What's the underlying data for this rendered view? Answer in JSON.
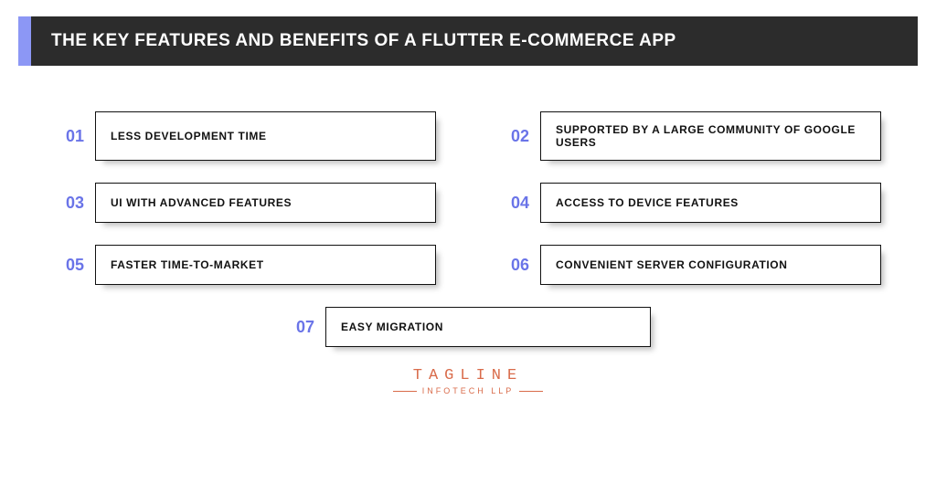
{
  "header": {
    "title": "THE KEY FEATURES AND BENEFITS OF A FLUTTER E-COMMERCE APP"
  },
  "items": [
    {
      "num": "01",
      "label": "LESS DEVELOPMENT TIME"
    },
    {
      "num": "02",
      "label": "SUPPORTED BY A LARGE COMMUNITY OF GOOGLE USERS"
    },
    {
      "num": "03",
      "label": "UI WITH ADVANCED FEATURES"
    },
    {
      "num": "04",
      "label": "ACCESS TO DEVICE FEATURES"
    },
    {
      "num": "05",
      "label": "FASTER TIME-TO-MARKET"
    },
    {
      "num": "06",
      "label": "CONVENIENT SERVER CONFIGURATION"
    },
    {
      "num": "07",
      "label": "EASY MIGRATION"
    }
  ],
  "logo": {
    "top": "TAGLINE",
    "bottom": "INFOTECH LLP"
  },
  "colors": {
    "accent": "#8c97f5",
    "number": "#6a74e8",
    "headerBg": "#2c2c2c",
    "logo": "#d96b4a"
  }
}
